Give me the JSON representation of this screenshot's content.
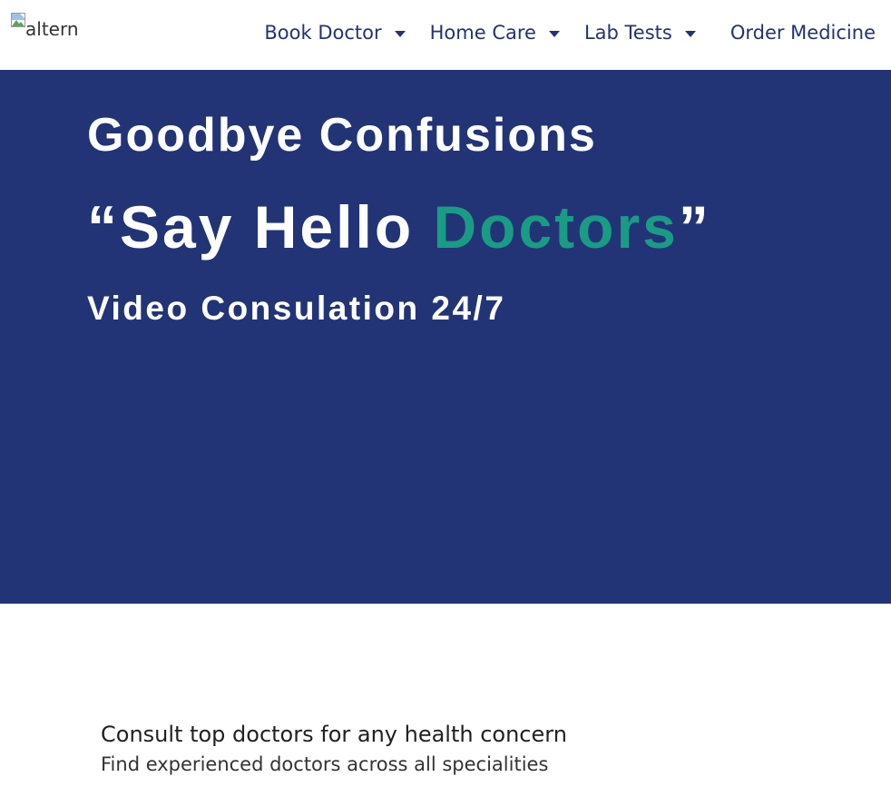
{
  "header": {
    "logo_alt": "altern",
    "nav": [
      {
        "label": "Book Doctor",
        "has_dropdown": true
      },
      {
        "label": "Home Care",
        "has_dropdown": true
      },
      {
        "label": "Lab Tests",
        "has_dropdown": true
      },
      {
        "label": "Order Medicine",
        "has_dropdown": false
      }
    ]
  },
  "hero": {
    "title": "Goodbye Confusions",
    "quote_open": "“Say Hello ",
    "quote_accent": "Doctors",
    "quote_close": "”",
    "subtitle": "Video Consulation 24/7"
  },
  "consult": {
    "title": "Consult top doctors for any health concern",
    "description": "Find experienced doctors across all specialities"
  },
  "colors": {
    "brand_navy": "#223476",
    "nav_text": "#233373",
    "accent_teal": "#1a9b86"
  }
}
